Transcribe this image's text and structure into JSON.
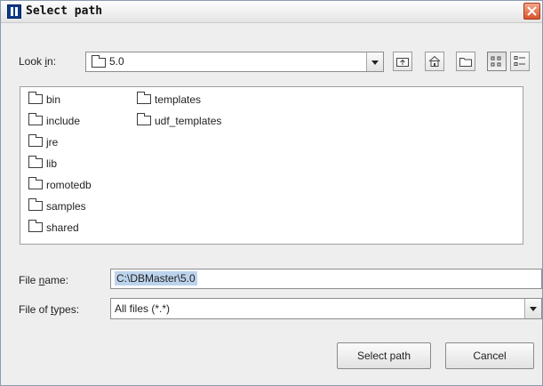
{
  "window": {
    "title": "Select path"
  },
  "look_in": {
    "label_pre": "Look ",
    "label_mnemonic": "i",
    "label_post": "n:",
    "value": "5.0",
    "folder_icon": "folder-icon"
  },
  "toolbar": {
    "up_icon": "up-one-level-icon",
    "home_icon": "home-icon",
    "new_folder_icon": "new-folder-icon",
    "list_view_icon": "list-view-icon",
    "details_view_icon": "details-view-icon",
    "selected_view": "list"
  },
  "files": {
    "column1": [
      "bin",
      "include",
      "jre",
      "lib",
      "romotedb",
      "samples",
      "shared"
    ],
    "column2": [
      "templates",
      "udf_templates"
    ]
  },
  "file_name": {
    "label_pre": "File ",
    "label_mnemonic": "n",
    "label_post": "ame:",
    "value": "C:\\DBMaster\\5.0"
  },
  "file_types": {
    "label_pre": "File of ",
    "label_mnemonic": "t",
    "label_post": "ypes:",
    "value": "All files (*.*)"
  },
  "buttons": {
    "select": "Select path",
    "cancel": "Cancel"
  },
  "colors": {
    "title_icon": "#0d3a8c",
    "close": "#d9532c",
    "selection": "#bcd3ec"
  }
}
